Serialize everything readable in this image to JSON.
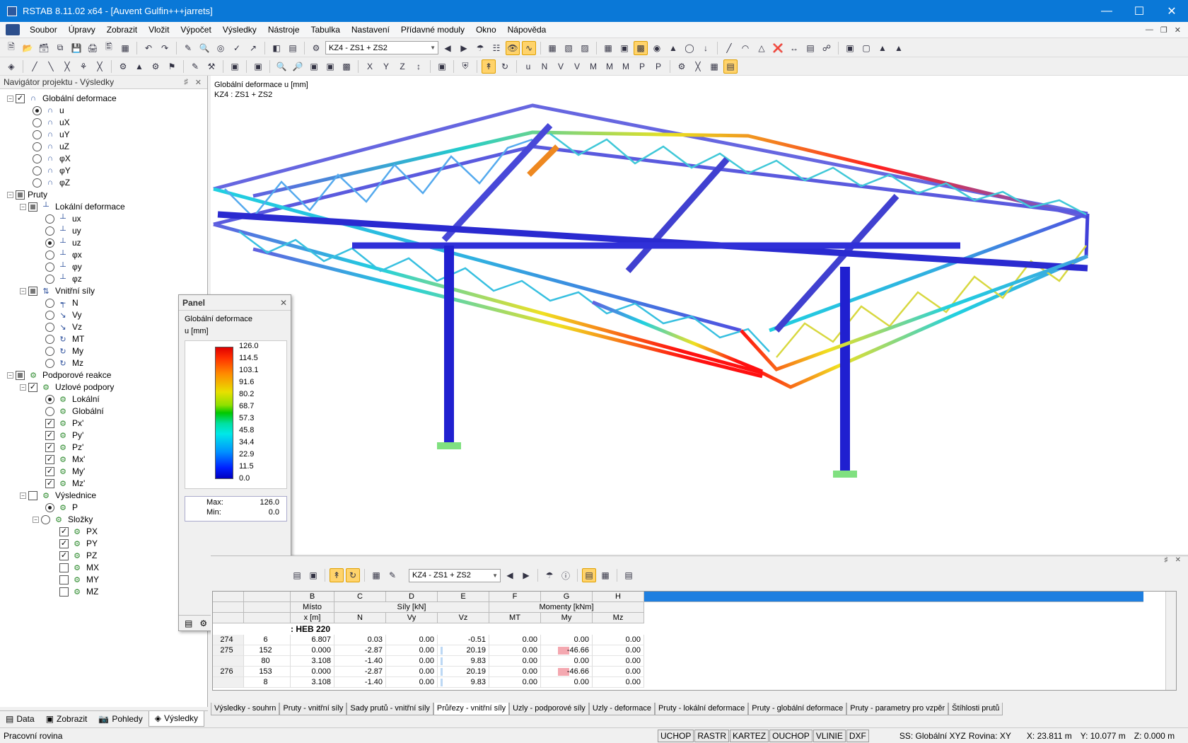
{
  "window": {
    "title": "RSTAB 8.11.02 x64 - [Auvent Gulfin+++jarrets]"
  },
  "menu": [
    "Soubor",
    "Úpravy",
    "Zobrazit",
    "Vložit",
    "Výpočet",
    "Výsledky",
    "Nástroje",
    "Tabulka",
    "Nastavení",
    "Přídavné moduly",
    "Okno",
    "Nápověda"
  ],
  "toolbar": {
    "load_combo": "KZ4 - ZS1 + ZS2"
  },
  "navigator": {
    "title": "Navigátor projektu - Výsledky",
    "global_def": "Globální deformace",
    "global_items": [
      "u",
      "uX",
      "uY",
      "uZ",
      "φX",
      "φY",
      "φZ"
    ],
    "members": "Pruty",
    "local_def": "Lokální deformace",
    "local_items": [
      "ux",
      "uy",
      "uz",
      "φx",
      "φy",
      "φz"
    ],
    "internal": "Vnitřní síly",
    "internal_items": [
      "N",
      "Vy",
      "Vz",
      "MT",
      "My",
      "Mz"
    ],
    "support": "Podporové reakce",
    "nodal": "Uzlové podpory",
    "nodal_items": [
      "Lokální",
      "Globální",
      "Px'",
      "Py'",
      "Pz'",
      "Mx'",
      "My'",
      "Mz'"
    ],
    "resultant": "Výslednice",
    "resultant_items": [
      "P",
      "Složky",
      "PX",
      "PY",
      "PZ",
      "MX",
      "MY",
      "MZ"
    ],
    "tabs": [
      "Data",
      "Zobrazit",
      "Pohledy",
      "Výsledky"
    ]
  },
  "panel": {
    "title": "Panel",
    "label1": "Globální deformace",
    "label2": "u [mm]",
    "values": [
      "126.0",
      "114.5",
      "103.1",
      "91.6",
      "80.2",
      "68.7",
      "57.3",
      "45.8",
      "34.4",
      "22.9",
      "11.5",
      "0.0"
    ],
    "max_label": "Max:",
    "max_value": "126.0",
    "min_label": "Min:",
    "min_value": "0.0"
  },
  "view": {
    "line1": "Globální deformace u [mm]",
    "line2": "KZ4 : ZS1 + ZS2"
  },
  "table": {
    "combo": "KZ4 - ZS1 + ZS2",
    "col_letters": [
      "B",
      "C",
      "D",
      "E",
      "F",
      "G",
      "H"
    ],
    "group1": "Místo",
    "group1b": "x [m]",
    "group2": "Síly [kN]",
    "group3": "Momenty [kNm]",
    "sub": [
      "N",
      "Vy",
      "Vz",
      "MT",
      "My",
      "Mz"
    ],
    "section": ": HEB 220",
    "rows": [
      {
        "idx": "274",
        "n": "6",
        "x": "6.807",
        "N": "0.03",
        "Vy": "0.00",
        "Vz": "-0.51",
        "MT": "0.00",
        "My": "0.00",
        "Mz": "0.00"
      },
      {
        "idx": "275",
        "n": "152",
        "x": "0.000",
        "N": "-2.87",
        "Vy": "0.00",
        "Vz": "20.19",
        "MT": "0.00",
        "My": "-46.66",
        "Mz": "0.00"
      },
      {
        "idx": "",
        "n": "80",
        "x": "3.108",
        "N": "-1.40",
        "Vy": "0.00",
        "Vz": "9.83",
        "MT": "0.00",
        "My": "0.00",
        "Mz": "0.00"
      },
      {
        "idx": "276",
        "n": "153",
        "x": "0.000",
        "N": "-2.87",
        "Vy": "0.00",
        "Vz": "20.19",
        "MT": "0.00",
        "My": "-46.66",
        "Mz": "0.00"
      },
      {
        "idx": "",
        "n": "8",
        "x": "3.108",
        "N": "-1.40",
        "Vy": "0.00",
        "Vz": "9.83",
        "MT": "0.00",
        "My": "0.00",
        "Mz": "0.00"
      }
    ],
    "tabs": [
      "Výsledky - souhrn",
      "Pruty - vnitřní síly",
      "Sady prutů - vnitřní síly",
      "Průřezy - vnitřní síly",
      "Uzly - podporové síly",
      "Uzly - deformace",
      "Pruty - lokální deformace",
      "Pruty - globální deformace",
      "Pruty - parametry pro vzpěr",
      "Štíhlosti prutů"
    ]
  },
  "status": {
    "left": "Pracovní rovina",
    "buttons": [
      "UCHOP",
      "RASTR",
      "KARTEZ",
      "OUCHOP",
      "VLINIE",
      "DXF"
    ],
    "ss": "SS: Globální XYZ",
    "plane": "Rovina: XY",
    "x": "X: 23.811 m",
    "y": "Y: 10.077 m",
    "z": "Z: 0.000 m"
  }
}
